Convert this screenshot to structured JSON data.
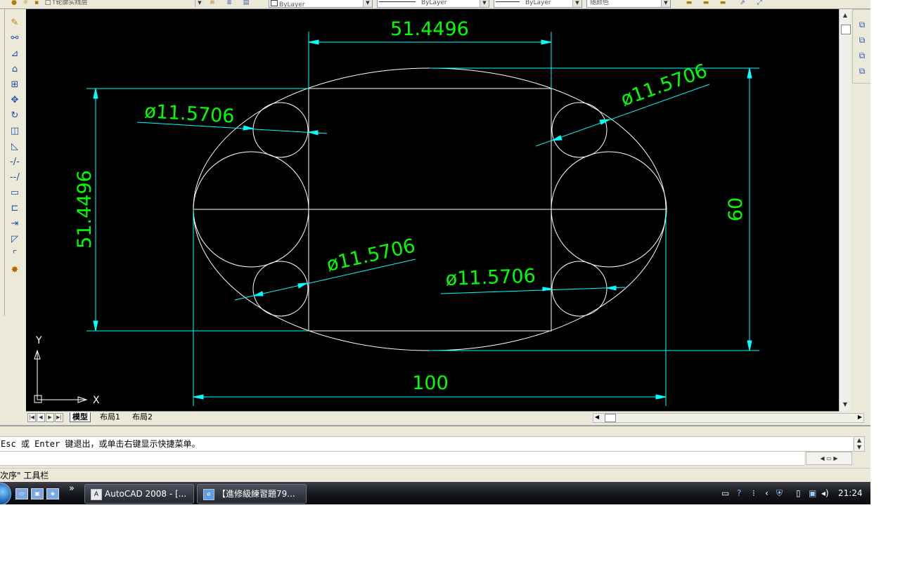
{
  "toolbar": {
    "layer_name": "T轮廓实线层",
    "color_value": "ByLayer",
    "linetype_value": "ByLayer",
    "lineweight_value": "ByLayer",
    "plotstyle_value": "随颜色"
  },
  "drawing": {
    "dim_top": "51.4496",
    "dim_left": "51.4496",
    "dim_bottom": "100",
    "dim_right": "60",
    "dia_top_left": "ø11.5706",
    "dia_top_right": "ø11.5706",
    "dia_bottom_left": "ø11.5706",
    "dia_bottom_right": "ø11.5706",
    "ucs_x": "X",
    "ucs_y": "Y",
    "colors": {
      "geometry": "#ffffff",
      "dimension": "#00ffff",
      "dim_text": "#00ff00",
      "background": "#000000"
    }
  },
  "tabs": {
    "model": "模型",
    "layout1": "布局1",
    "layout2": "布局2"
  },
  "command": {
    "line1": "Esc 或 Enter 键退出，或单击右键显示快捷菜单。",
    "line2": ""
  },
  "status": {
    "text": "次序\" 工具栏"
  },
  "taskbar": {
    "autocad_button": "AutoCAD 2008 - [...",
    "ie_button": "【進修級練習題79...",
    "overflow": "»",
    "clock": "21:24"
  }
}
